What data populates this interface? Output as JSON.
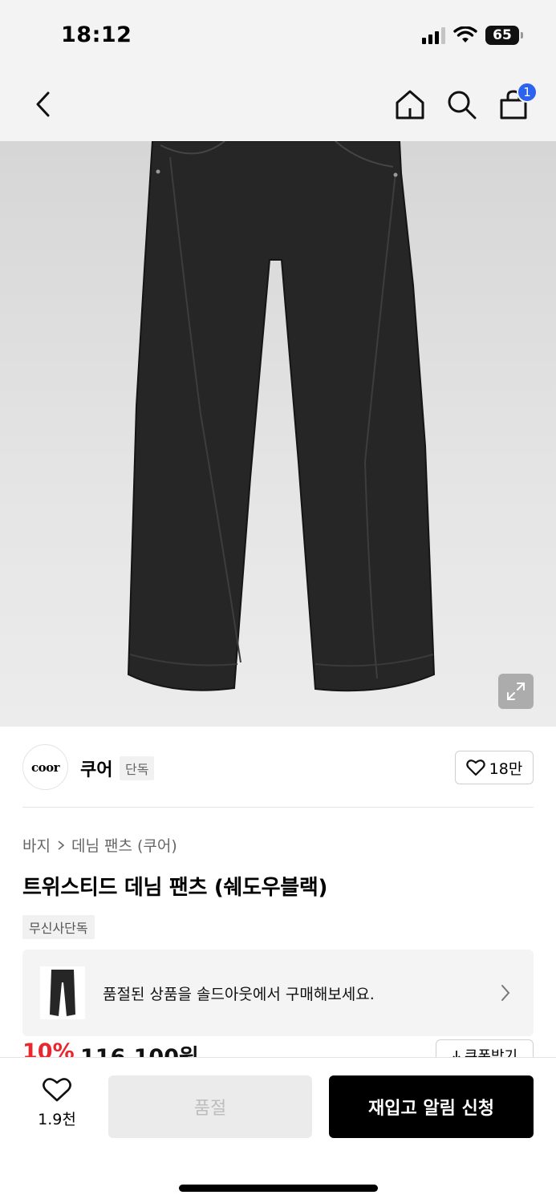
{
  "status_bar": {
    "time": "18:12",
    "battery": "65"
  },
  "nav": {
    "cart_count": "1"
  },
  "brand": {
    "logo_text": "coor",
    "name": "쿠어",
    "tag": "단독",
    "likes": "18만"
  },
  "breadcrumb": [
    "바지",
    "데님 팬츠 (쿠어)"
  ],
  "product": {
    "title": "트위스티드 데님 팬츠 (쉐도우블랙)",
    "badge": "무신사단독",
    "discount": "10%",
    "price": "116,100원",
    "coupon_label": "쿠폰받기"
  },
  "soldout_banner": {
    "text": "품절된 상품을 솔드아웃에서 구매해보세요."
  },
  "bottom": {
    "wish_count": "1.9천",
    "soldout_label": "품절",
    "restock_label": "재입고 알림 신청"
  }
}
